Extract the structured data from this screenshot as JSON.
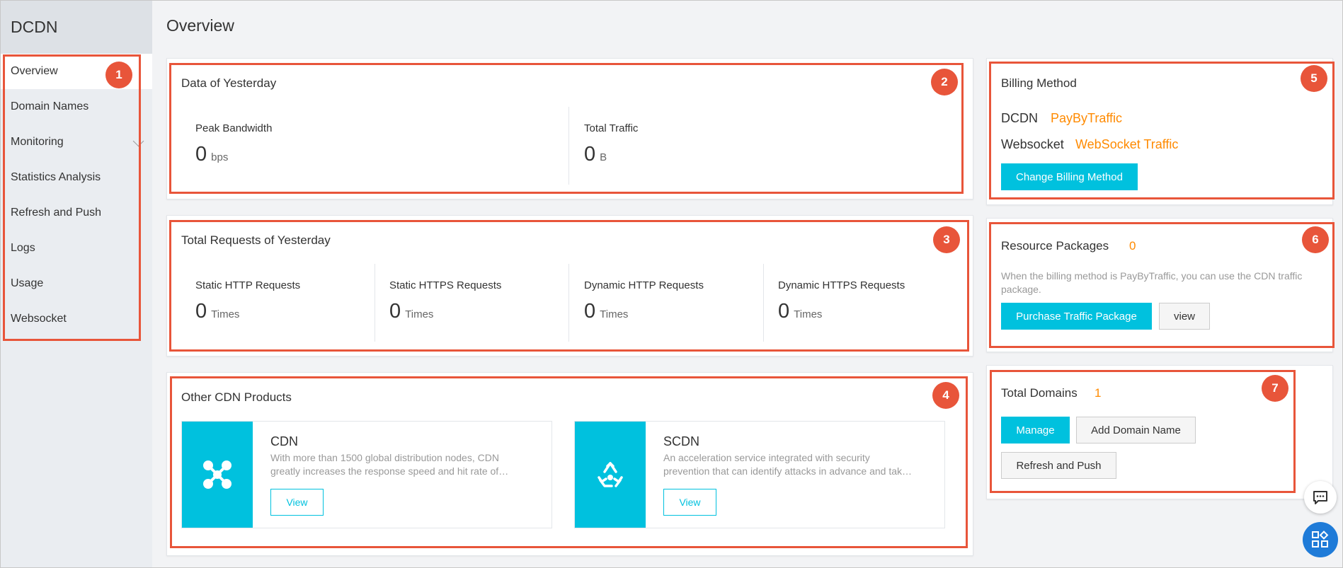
{
  "sidebar": {
    "brand": "DCDN",
    "items": [
      {
        "label": "Overview"
      },
      {
        "label": "Domain Names"
      },
      {
        "label": "Monitoring"
      },
      {
        "label": "Statistics Analysis"
      },
      {
        "label": "Refresh and Push"
      },
      {
        "label": "Logs"
      },
      {
        "label": "Usage"
      },
      {
        "label": "Websocket"
      }
    ]
  },
  "page": {
    "title": "Overview"
  },
  "yesterday": {
    "title": "Data of Yesterday",
    "peak_label": "Peak Bandwidth",
    "peak_value": "0",
    "peak_unit": "bps",
    "traffic_label": "Total Traffic",
    "traffic_value": "0",
    "traffic_unit": "B"
  },
  "requests": {
    "title": "Total Requests of Yesterday",
    "items": [
      {
        "label": "Static HTTP Requests",
        "value": "0",
        "unit": "Times"
      },
      {
        "label": "Static HTTPS Requests",
        "value": "0",
        "unit": "Times"
      },
      {
        "label": "Dynamic HTTP Requests",
        "value": "0",
        "unit": "Times"
      },
      {
        "label": "Dynamic HTTPS Requests",
        "value": "0",
        "unit": "Times"
      }
    ]
  },
  "products": {
    "title": "Other CDN Products",
    "items": [
      {
        "name": "CDN",
        "desc": "With more than 1500 global distribution nodes, CDN greatly increases the response speed and hit rate of…",
        "button": "View",
        "icon": "cdn-nodes-icon"
      },
      {
        "name": "SCDN",
        "desc": "An acceleration service integrated with security prevention that can identify attacks in advance and tak…",
        "button": "View",
        "icon": "scdn-recycle-icon"
      }
    ]
  },
  "billing": {
    "title": "Billing Method",
    "dcdn_label": "DCDN",
    "dcdn_value": "PayByTraffic",
    "ws_label": "Websocket",
    "ws_value": "WebSocket Traffic",
    "change_button": "Change Billing Method"
  },
  "resources": {
    "title": "Resource Packages",
    "count": "0",
    "hint": "When the billing method is PayByTraffic, you can use the CDN traffic package.",
    "purchase_button": "Purchase Traffic Package",
    "view_button": "view"
  },
  "domains": {
    "title": "Total Domains",
    "count": "1",
    "manage_button": "Manage",
    "add_button": "Add Domain Name",
    "refresh_button": "Refresh and Push"
  },
  "annotations": [
    "1",
    "2",
    "3",
    "4",
    "5",
    "6",
    "7"
  ],
  "colors": {
    "accent": "#00c1de",
    "highlight": "#ff8a00",
    "annotation": "#e8553a"
  }
}
